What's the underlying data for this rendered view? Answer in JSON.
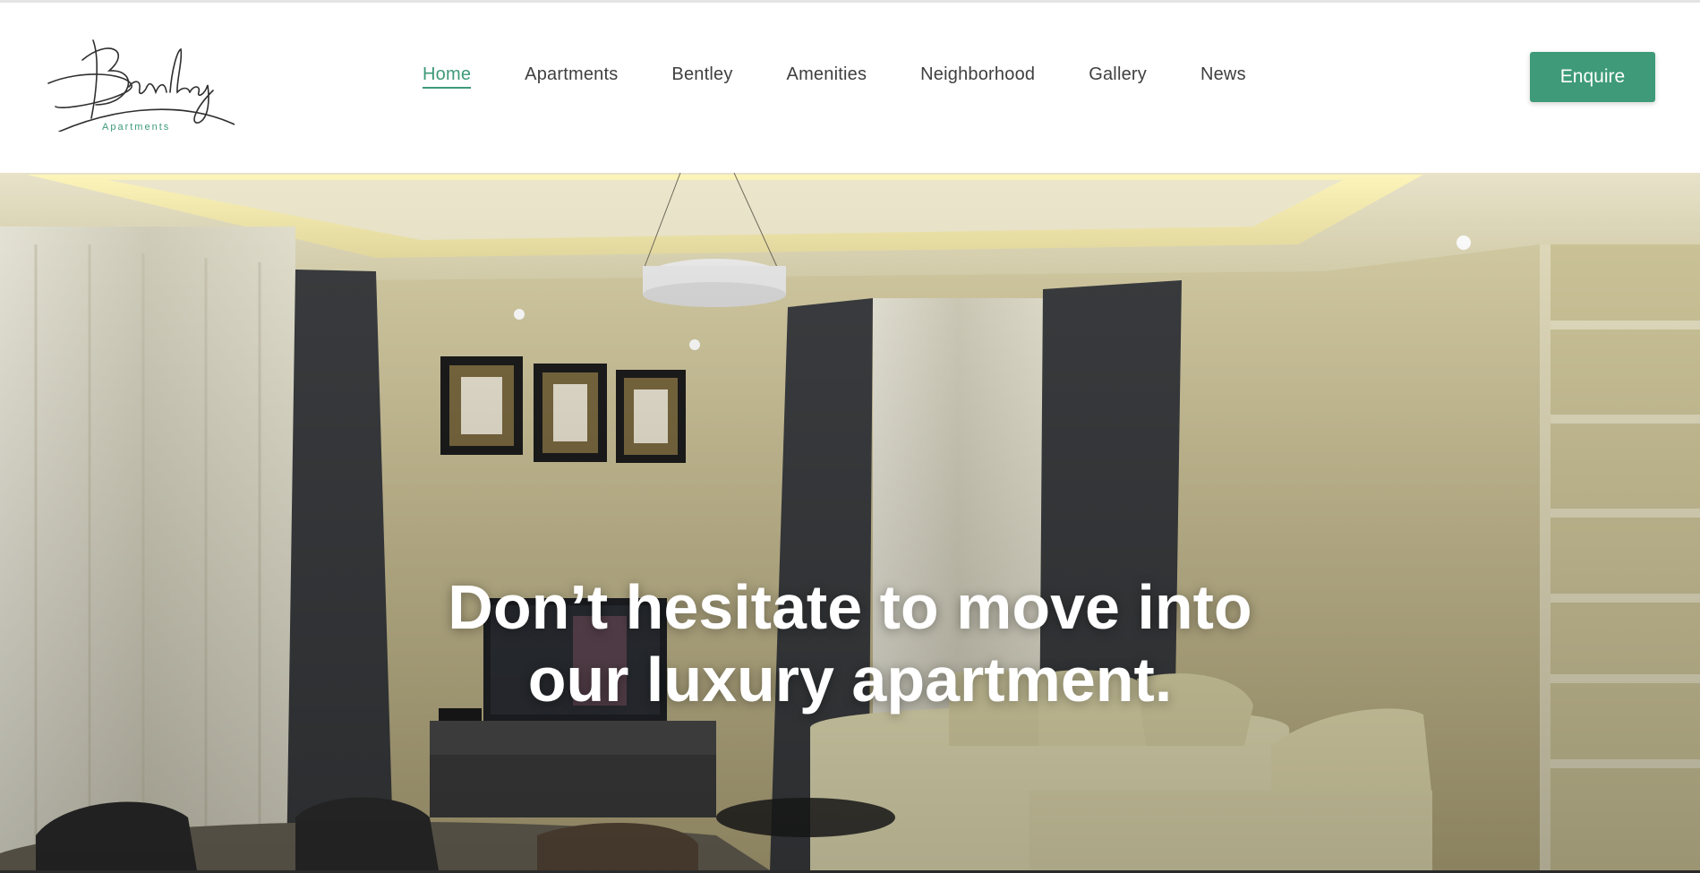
{
  "brand": {
    "logo_script": "Bentley",
    "logo_sub": "Apartments",
    "accent_color": "#3e9a79"
  },
  "nav": {
    "items": [
      {
        "label": "Home",
        "active": true
      },
      {
        "label": "Apartments"
      },
      {
        "label": "Bentley"
      },
      {
        "label": "Amenities"
      },
      {
        "label": "Neighborhood"
      },
      {
        "label": "Gallery"
      },
      {
        "label": "News"
      }
    ]
  },
  "header": {
    "enquire_label": "Enquire"
  },
  "hero": {
    "heading_line1": "Don’t hesitate to move into",
    "heading_line2": "our luxury apartment."
  }
}
